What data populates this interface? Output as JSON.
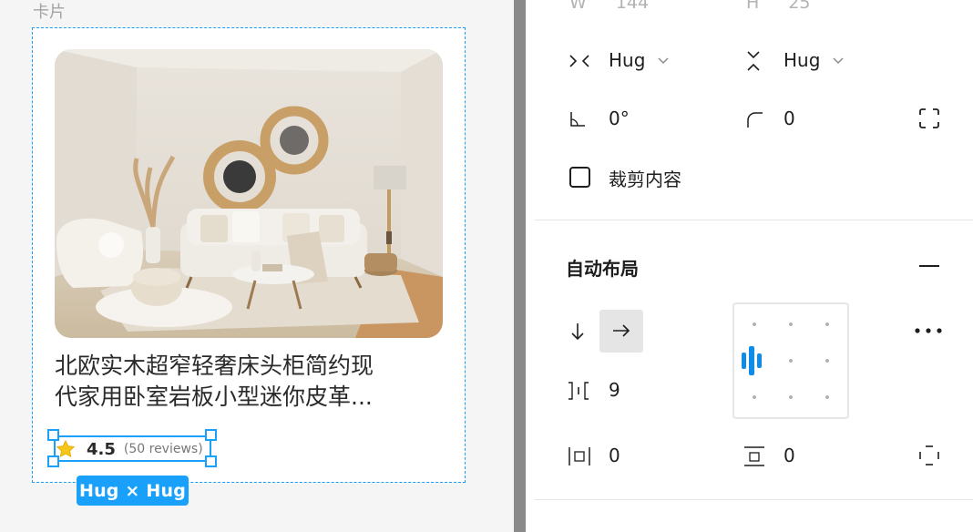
{
  "canvas": {
    "frame_label": "卡片",
    "card": {
      "title_lines": [
        "北欧实木超窄轻奢床头柜简约现",
        "代家用卧室岩板小型迷你皮革..."
      ],
      "rating": {
        "score": "4.5",
        "reviews": "(50 reviews)"
      }
    },
    "size_badge": "Hug × Hug"
  },
  "panel": {
    "dimensions": {
      "w_label": "W",
      "w_value": "144",
      "h_label": "H",
      "h_value": "25"
    },
    "resizing": {
      "horizontal": "Hug",
      "vertical": "Hug"
    },
    "rotation": "0°",
    "corner_radius": "0",
    "clip_content_label": "裁剪内容",
    "auto_layout": {
      "title": "自动布局",
      "gap": "9",
      "padding_horizontal": "0",
      "padding_vertical": "0"
    }
  },
  "colors": {
    "selection": "#18a0fb",
    "accent": "#0d8ce9",
    "star": "#f5c518"
  }
}
